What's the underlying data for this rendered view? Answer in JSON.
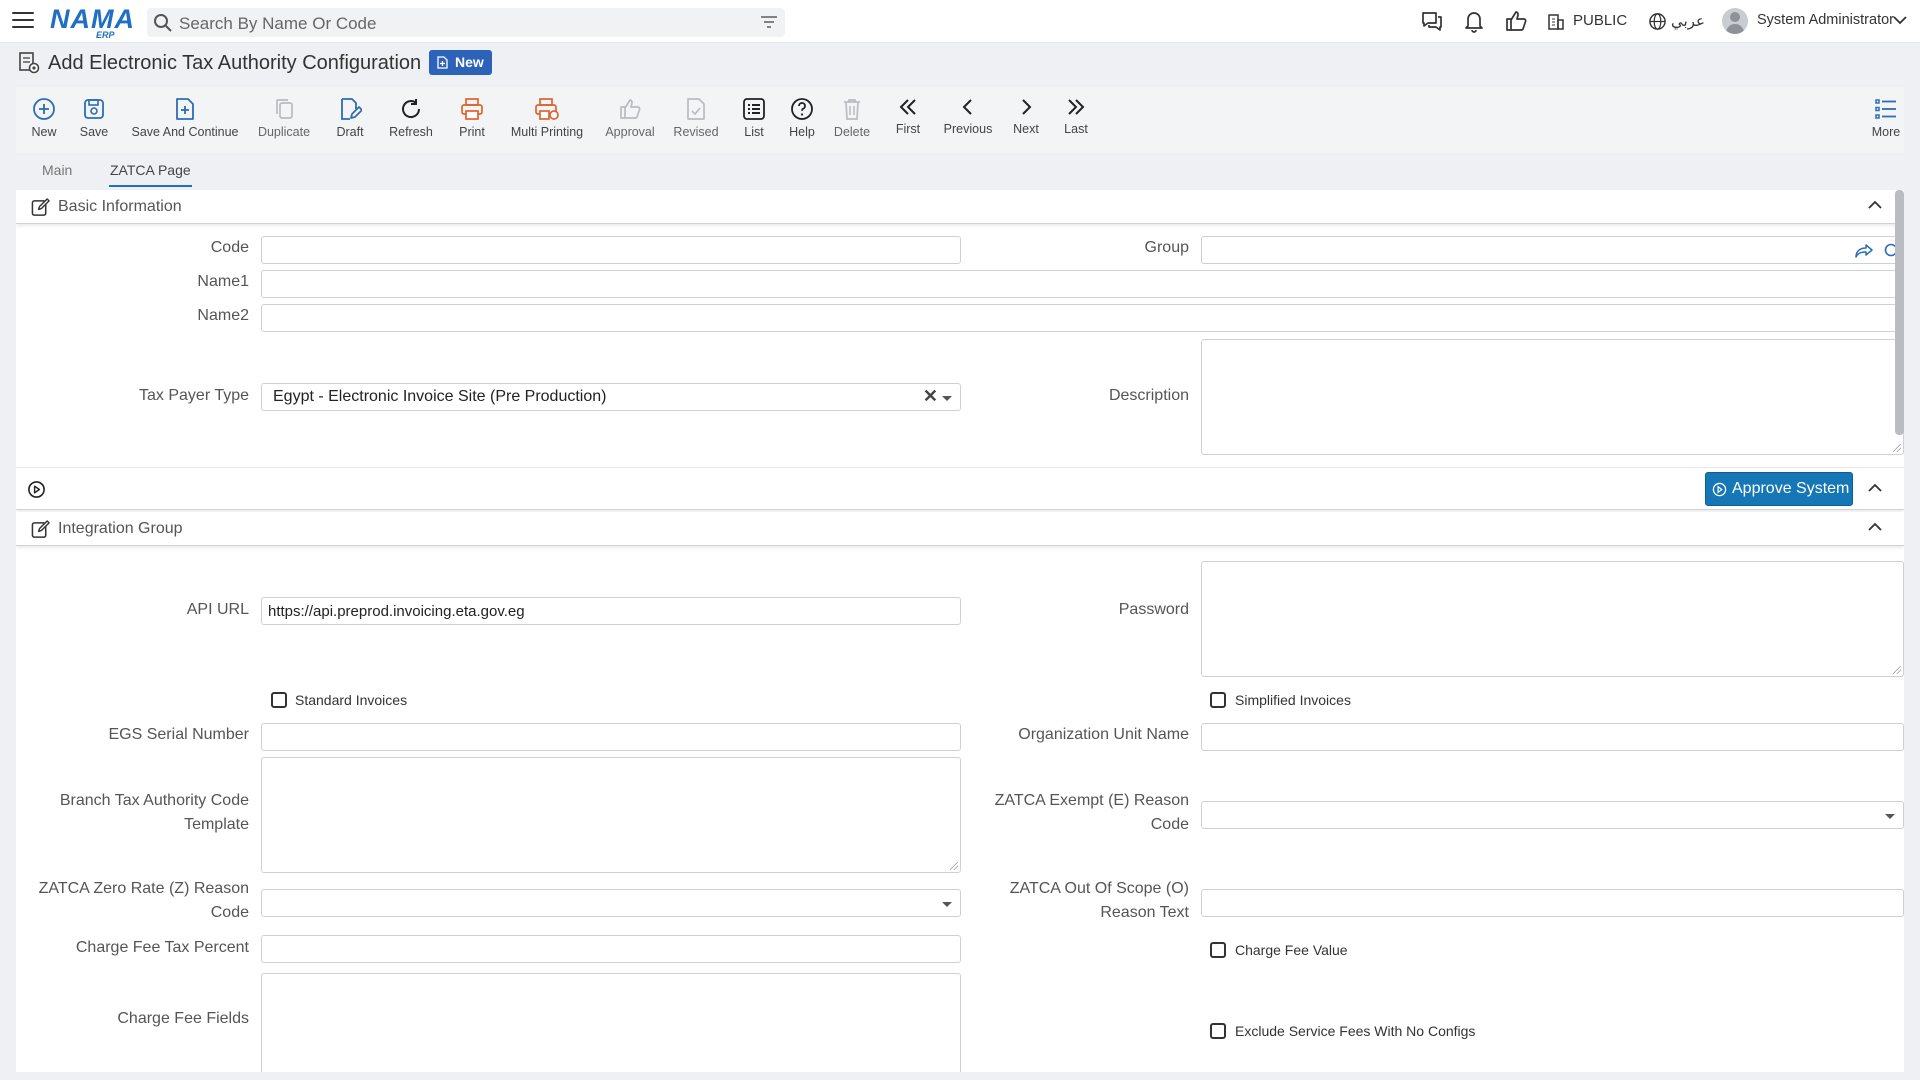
{
  "app": {
    "logo_text": "NAMA",
    "logo_sub": "ERP",
    "search_placeholder": "Search By Name Or Code",
    "public_label": "PUBLIC",
    "language_label": "عربي",
    "user_name": "System Administrator"
  },
  "page": {
    "title": "Add Electronic Tax Authority Configuration",
    "badge": "New"
  },
  "toolbar": {
    "new": "New",
    "save": "Save",
    "save_continue": "Save And Continue",
    "duplicate": "Duplicate",
    "draft": "Draft",
    "refresh": "Refresh",
    "print": "Print",
    "multi_printing": "Multi Printing",
    "approval": "Approval",
    "revised": "Revised",
    "list": "List",
    "help": "Help",
    "delete": "Delete",
    "first": "First",
    "previous": "Previous",
    "next": "Next",
    "last": "Last",
    "more": "More"
  },
  "tabs": {
    "main": "Main",
    "zatca": "ZATCA Page"
  },
  "basic_info": {
    "title": "Basic Information",
    "code_label": "Code",
    "code_value": "",
    "group_label": "Group",
    "group_value": "",
    "name1_label": "Name1",
    "name1_value": "",
    "name2_label": "Name2",
    "name2_value": "",
    "tax_payer_type_label": "Tax Payer Type",
    "tax_payer_type_value": "Egypt - Electronic Invoice Site (Pre Production)",
    "description_label": "Description",
    "description_value": ""
  },
  "approve": {
    "button": "Approve System"
  },
  "integration": {
    "title": "Integration Group",
    "api_url_label": "API URL",
    "api_url_value": "https://api.preprod.invoicing.eta.gov.eg",
    "password_label": "Password",
    "standard_invoices_label": "Standard Invoices",
    "standard_invoices_checked": false,
    "simplified_invoices_label": "Simplified Invoices",
    "simplified_invoices_checked": false,
    "egs_serial_label": "EGS Serial Number",
    "org_unit_label": "Organization Unit Name",
    "branch_template_label_1": "Branch Tax Authority Code",
    "branch_template_label_2": "Template",
    "exempt_reason_label_1": "ZATCA Exempt (E) Reason",
    "exempt_reason_label_2": "Code",
    "zero_rate_label_1": "ZATCA Zero Rate (Z) Reason",
    "zero_rate_label_2": "Code",
    "out_of_scope_label_1": "ZATCA Out Of Scope (O)",
    "out_of_scope_label_2": "Reason Text",
    "charge_fee_tax_label": "Charge Fee Tax Percent",
    "charge_fee_value_label": "Charge Fee Value",
    "charge_fee_value_checked": false,
    "charge_fee_fields_label": "Charge Fee Fields",
    "exclude_service_fees_label": "Exclude Service Fees With No Configs",
    "exclude_service_fees_checked": false
  }
}
